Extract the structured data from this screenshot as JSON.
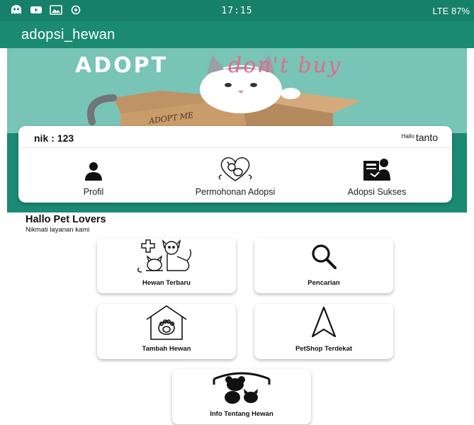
{
  "status_bar": {
    "time": "17:15",
    "right": "LTE 87%",
    "left_icons": [
      "app-notification-icon",
      "youtube-icon",
      "image-icon",
      "hotspot-icon"
    ]
  },
  "app_bar": {
    "title": "adopsi_hewan"
  },
  "banner": {
    "word1": "ADOPT",
    "word2": "don't buy",
    "box_text": "ADOPT ME"
  },
  "user_card": {
    "nik_label": "nik :",
    "nik_value": "123",
    "greeting": "Hallo",
    "username": "tanto",
    "menu": [
      {
        "label": "Profil",
        "icon": "person-icon"
      },
      {
        "label": "Permohonan Adopsi",
        "icon": "pet-adoption-icon"
      },
      {
        "label": "Adopsi Sukses",
        "icon": "adoption-success-icon"
      }
    ]
  },
  "section": {
    "title": "Hallo Pet Lovers",
    "subtitle": "Nikmati layanan kami"
  },
  "tiles": [
    {
      "label": "Hewan Terbaru",
      "icon": "pets-with-cross-icon"
    },
    {
      "label": "Pencarian",
      "icon": "search-icon"
    },
    {
      "label": "Tambah Hewan",
      "icon": "pet-house-icon"
    },
    {
      "label": "PetShop Terdekat",
      "icon": "navigation-arrow-icon"
    },
    {
      "label": "Info Tentang Hewan",
      "icon": "animals-info-icon"
    }
  ],
  "colors": {
    "primary": "#1a8a72",
    "status_bar": "#17806a",
    "banner_bg": "#78c4b6"
  }
}
